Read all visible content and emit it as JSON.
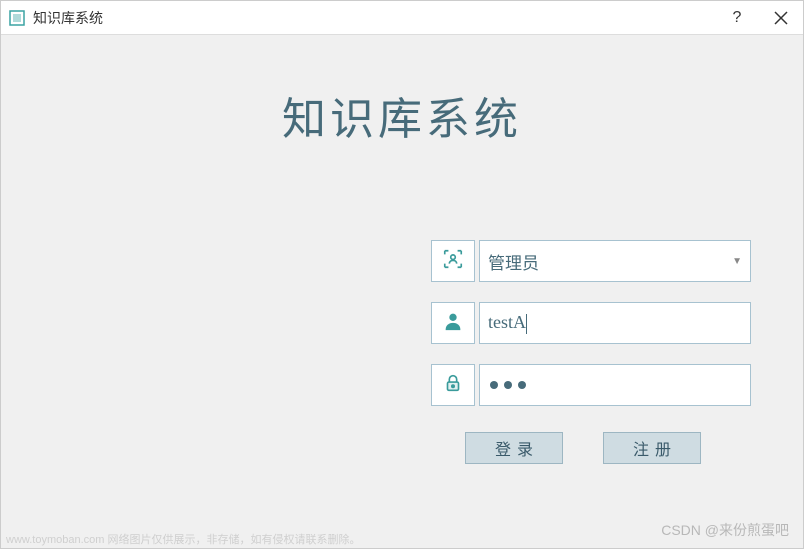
{
  "window": {
    "title": "知识库系统"
  },
  "heading": "知识库系统",
  "form": {
    "role": {
      "selected": "管理员"
    },
    "username": {
      "value": "testA"
    },
    "password": {
      "masked": "•••"
    }
  },
  "buttons": {
    "login": "登录",
    "register": "注册"
  },
  "watermark": {
    "bottom_right": "CSDN @来份煎蛋吧",
    "bottom_left": "www.toymoban.com 网络图片仅供展示，非存储，如有侵权请联系删除。"
  },
  "colors": {
    "accent": "#476b7a",
    "border": "#a7c2d0",
    "button_bg": "#cfdce2"
  }
}
